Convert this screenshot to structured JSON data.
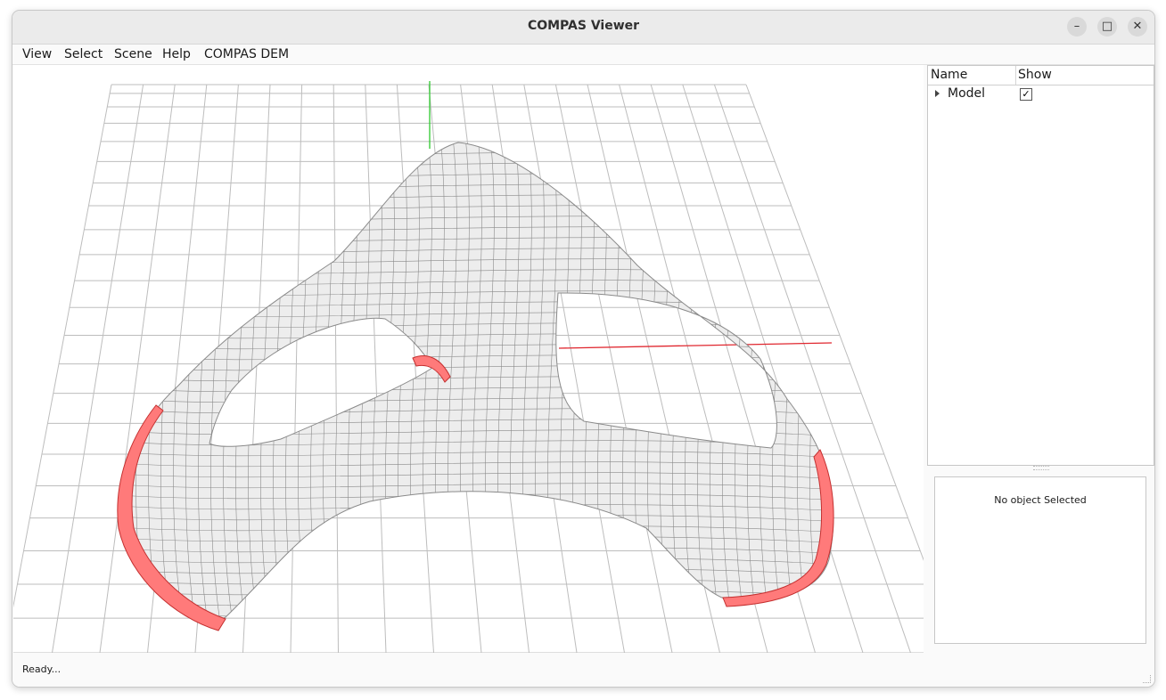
{
  "window": {
    "title": "COMPAS Viewer",
    "controls": {
      "minimize": "–",
      "maximize": "□",
      "close": "✕"
    }
  },
  "menubar": {
    "items": [
      "View",
      "Select",
      "Scene",
      "Help",
      "COMPAS DEM"
    ]
  },
  "object_tree": {
    "columns": [
      "Name",
      "Show"
    ],
    "rows": [
      {
        "name": "Model",
        "show": "✓",
        "expanded": false
      }
    ]
  },
  "properties": {
    "empty_text": "No object Selected"
  },
  "status": {
    "text": "Ready..."
  },
  "scene": {
    "colors": {
      "grid": "#bdbdbd",
      "x_axis": "#e0262e",
      "y_axis": "#2ec92e",
      "block_fill": "#ededed",
      "block_edge": "#8a8a8a",
      "support_fill": "#ff7a7a",
      "support_edge": "#c43030"
    }
  }
}
